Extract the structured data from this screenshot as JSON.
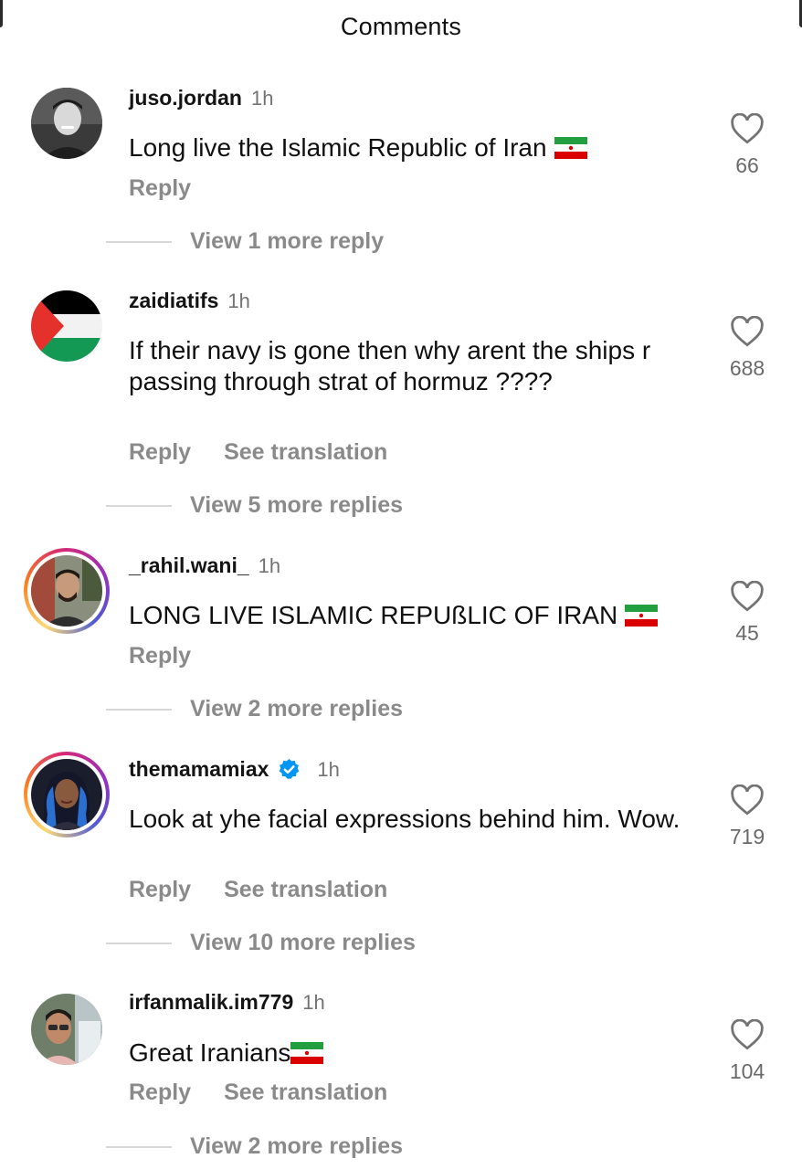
{
  "header": {
    "title": "Comments"
  },
  "colors": {
    "muted": "#8a8a8a",
    "verified": "#0095f6",
    "flag_green": "#239f40",
    "flag_red": "#da0000"
  },
  "comments": [
    {
      "username": "juso.jordan",
      "time": "1h",
      "text": "Long live the Islamic Republic of Iran",
      "reply_label": "Reply",
      "view_more": "View 1 more reply",
      "likes": "66",
      "avatar": "man-portrait-grayscale",
      "flag": "iran-flag"
    },
    {
      "username": "zaidiatifs",
      "time": "1h",
      "text": "If their navy is gone then why arent the ships r passing through strat of hormuz ????",
      "reply_label": "Reply",
      "translate_label": "See translation",
      "view_more": "View 5 more replies",
      "likes": "688",
      "avatar": "palestine-flag"
    },
    {
      "username": "_rahil.wani_",
      "time": "1h",
      "text": "LONG LIVE ISLAMIC REPUßLIC OF IRAN",
      "reply_label": "Reply",
      "view_more": "View 2 more replies",
      "likes": "45",
      "avatar": "man-portrait-story",
      "flag": "iran-flag"
    },
    {
      "username": "themamamiax",
      "verified": true,
      "time": "1h",
      "text": "Look at yhe facial expressions behind him. Wow.",
      "reply_label": "Reply",
      "translate_label": "See translation",
      "view_more": "View 10 more replies",
      "likes": "719",
      "avatar": "woman-portrait-story"
    },
    {
      "username": "irfanmalik.im779",
      "time": "1h",
      "text": "Great Iranians",
      "reply_label": "Reply",
      "translate_label": "See translation",
      "view_more": "View 2 more replies",
      "likes": "104",
      "avatar": "man-portrait-outdoor",
      "flag": "iran-flag"
    }
  ]
}
